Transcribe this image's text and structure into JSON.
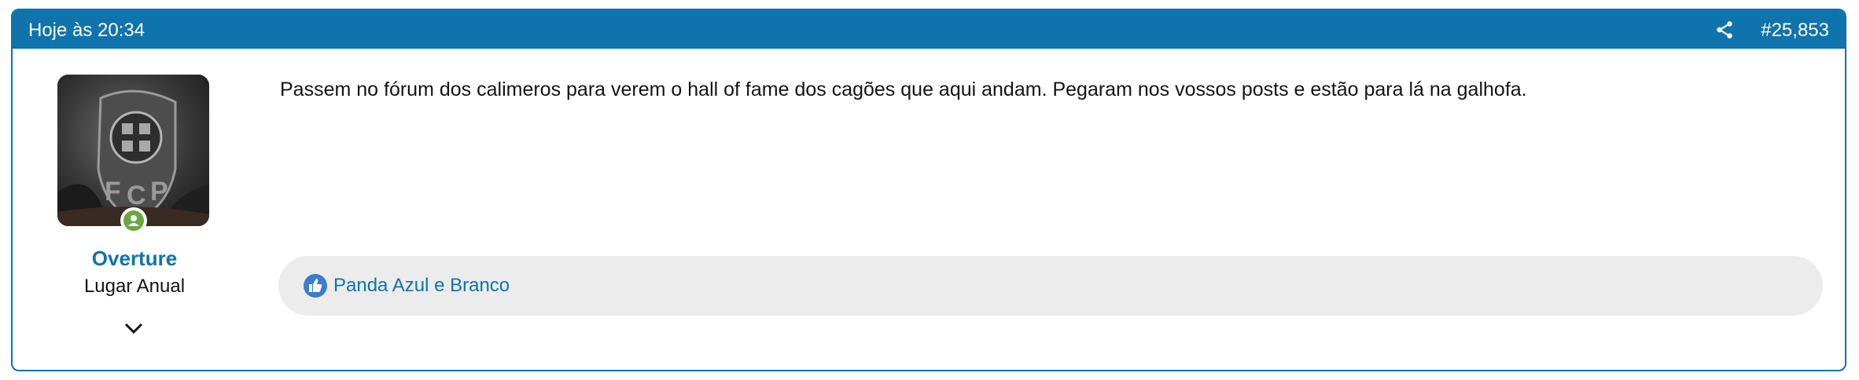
{
  "post": {
    "date": "Hoje às 20:34",
    "number": "#25,853",
    "share_icon": "share-icon"
  },
  "user": {
    "name": "Overture",
    "title": "Lugar Anual",
    "avatar_icon": "avatar-fcp-crest",
    "online_icon": "user-online-icon",
    "expand_icon": "chevron-down-icon"
  },
  "message": {
    "text": "Passem no fórum dos calimeros para verem o hall of fame dos cagões que aqui andam. Pegaram nos vossos posts e estão para lá na galhofa."
  },
  "reactions": {
    "icon": "thumbs-up-icon",
    "users_text": "Panda Azul e Branco"
  },
  "colors": {
    "accent": "#0f73ad",
    "online": "#6aa83f",
    "like": "#3b7ccf",
    "reaction_bar": "#ececec",
    "text": "#141414"
  }
}
